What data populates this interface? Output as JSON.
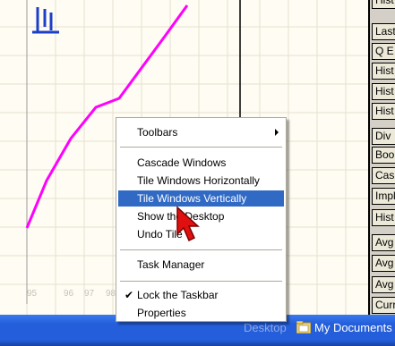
{
  "chart": {
    "line_color": "#ff00ff",
    "x_tick_labels": [
      "95",
      "96",
      "97",
      "98"
    ]
  },
  "right_buttons": [
    "Hist",
    "Last",
    "Q E",
    "Hist",
    "Hist",
    "Hist",
    "Div",
    "Boo",
    "Cas",
    "Impl",
    "Hist",
    "Avg",
    "Avg",
    "Avg",
    "Curr"
  ],
  "taskbar": {
    "desktop_label": "Desktop",
    "my_documents_label": "My Documents"
  },
  "menu": {
    "toolbars": "Toolbars",
    "cascade": "Cascade Windows",
    "tile_h": "Tile Windows Horizontally",
    "tile_v": "Tile Windows Vertically",
    "show_desktop": "Show the Desktop",
    "undo_tile": "Undo Tile",
    "task_manager": "Task Manager",
    "lock_taskbar": "Lock the Taskbar",
    "properties": "Properties",
    "selected_color": "#316ac5"
  }
}
